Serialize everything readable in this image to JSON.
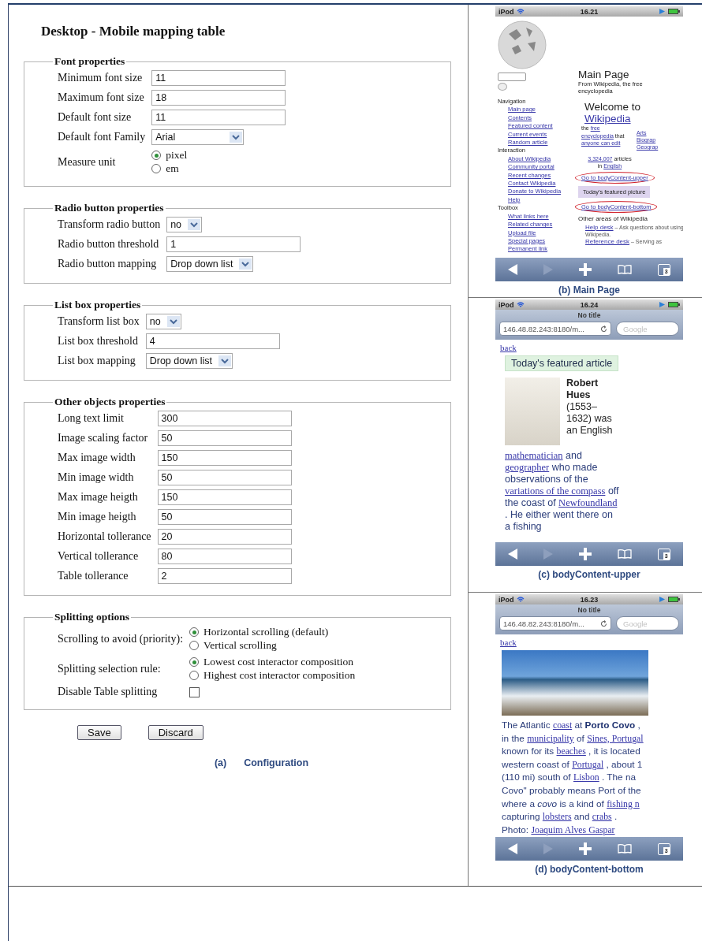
{
  "config": {
    "title": "Desktop - Mobile mapping table",
    "fieldsets": [
      {
        "legend": "Font properties",
        "rows": [
          {
            "kind": "text",
            "label": "Minimum font size",
            "value": "11"
          },
          {
            "kind": "text",
            "label": "Maximum font size",
            "value": "18"
          },
          {
            "kind": "text",
            "label": "Default font size",
            "value": "11"
          },
          {
            "kind": "select",
            "label": "Default font Family",
            "value": "Arial"
          },
          {
            "kind": "radio",
            "label": "Measure unit",
            "options": [
              {
                "label": "pixel",
                "selected": true
              },
              {
                "label": "em",
                "selected": false
              }
            ]
          }
        ]
      },
      {
        "legend": "Radio button properties",
        "rows": [
          {
            "kind": "select",
            "label": "Transform radio button",
            "value": "no"
          },
          {
            "kind": "text",
            "label": "Radio button threshold",
            "value": "1"
          },
          {
            "kind": "select",
            "label": "Radio button mapping",
            "value": "Drop down list"
          }
        ]
      },
      {
        "legend": "List box properties",
        "rows": [
          {
            "kind": "select",
            "label": "Transform list box",
            "value": "no"
          },
          {
            "kind": "text",
            "label": "List box threshold",
            "value": "4"
          },
          {
            "kind": "select",
            "label": "List box mapping",
            "value": "Drop down list"
          }
        ]
      },
      {
        "legend": "Other objects properties",
        "rows": [
          {
            "kind": "text",
            "label": "Long text limit",
            "value": "300"
          },
          {
            "kind": "text",
            "label": "Image scaling factor",
            "value": "50"
          },
          {
            "kind": "text",
            "label": "Max image width",
            "value": "150"
          },
          {
            "kind": "text",
            "label": "Min image width",
            "value": "50"
          },
          {
            "kind": "text",
            "label": "Max image heigth",
            "value": "150"
          },
          {
            "kind": "text",
            "label": "Min image heigth",
            "value": "50"
          },
          {
            "kind": "text",
            "label": "Horizontal tollerance",
            "value": "20"
          },
          {
            "kind": "text",
            "label": "Vertical tollerance",
            "value": "80"
          },
          {
            "kind": "text",
            "label": "Table tollerance",
            "value": "2"
          }
        ]
      },
      {
        "legend": "Splitting options",
        "rows": [
          {
            "kind": "radio",
            "label": "Scrolling to avoid (priority):",
            "options": [
              {
                "label": "Horizontal scrolling (default)",
                "selected": true
              },
              {
                "label": "Vertical scrolling",
                "selected": false
              }
            ]
          },
          {
            "kind": "radio",
            "label": "Splitting selection rule:",
            "options": [
              {
                "label": "Lowest cost interactor composition",
                "selected": true
              },
              {
                "label": "Highest cost interactor composition",
                "selected": false
              }
            ]
          },
          {
            "kind": "checkbox",
            "label": "Disable Table splitting",
            "checked": false
          }
        ]
      }
    ],
    "buttons": [
      "Save",
      "Discard"
    ],
    "caption": {
      "label": "(a)",
      "text": "Configuration"
    }
  },
  "phones": [
    {
      "caption": "(b) Main Page",
      "status": {
        "carrier": "iPod",
        "time": "16.21"
      },
      "toolbar": {
        "forward_enabled": false,
        "tab_count": "3"
      },
      "content": {
        "kind": "wiki-main",
        "sections": [
          {
            "heading": "Navigation",
            "links": [
              "Main page",
              "Contents",
              "Featured content",
              "Current events",
              "Random article"
            ]
          },
          {
            "heading": "Interaction",
            "links": [
              "About Wikipedia",
              "Community portal",
              "Recent changes",
              "Contact Wikipedia",
              "Donate to Wikipedia",
              "Help"
            ]
          },
          {
            "heading": "Toolbox",
            "links": [
              "What links here",
              "Related changes",
              "Upload file",
              "Special pages",
              "Permanent link"
            ]
          }
        ],
        "title": "Main Page",
        "subtitle": "From Wikipedia, the free encyclopedia",
        "welcome": "Welcome to",
        "welcome_link": "Wikipedia",
        "tagline": [
          {
            "text": "the "
          },
          {
            "link": "free"
          },
          {
            "link": "encyclopedia"
          },
          {
            "text": " that "
          },
          {
            "link": "anyone can edit"
          }
        ],
        "portals": [
          "Arts",
          "Biograp",
          "Geograp"
        ],
        "count": [
          {
            "link": "3,324,007"
          },
          {
            "text": " articles in "
          },
          {
            "link": "English"
          }
        ],
        "items": [
          {
            "kind": "jump",
            "text": "Go to bodyContent-upper",
            "circled": true
          },
          {
            "kind": "box",
            "text": "Today's featured picture"
          },
          {
            "kind": "jump",
            "text": "Go to bodyContent-bottom",
            "circled": true
          },
          {
            "kind": "heading",
            "text": "Other areas of Wikipedia"
          },
          {
            "kind": "entry",
            "link": "Help desk",
            "text": " – Ask questions about using Wikipedia."
          },
          {
            "kind": "entry",
            "link": "Reference desk",
            "text": " – Serving as"
          }
        ]
      }
    },
    {
      "caption": "(c) bodyContent-upper",
      "status": {
        "carrier": "iPod",
        "time": "16.24"
      },
      "nav": {
        "title": "No title",
        "url": "146.48.82.243:8180/m...",
        "search_placeholder": "Google"
      },
      "toolbar": {
        "forward_enabled": false,
        "tab_count": "3"
      },
      "content": {
        "kind": "article",
        "blocks": [
          {
            "kind": "link",
            "text": "back"
          },
          {
            "kind": "box",
            "text": "Today's featured article"
          },
          {
            "kind": "figure",
            "segments": [
              {
                "bold": "Robert Hues"
              },
              {
                "text": " (1553–1632) was an English"
              }
            ]
          },
          {
            "kind": "paragraph",
            "segments": [
              {
                "link": "mathematician"
              },
              {
                "text": " and "
              },
              {
                "link": "geographer"
              },
              {
                "text": " who made observations of the "
              },
              {
                "link": "variations of the compass"
              },
              {
                "text": " off the coast of "
              },
              {
                "link": "Newfoundland"
              },
              {
                "text": " . He either went there on a fishing"
              }
            ]
          }
        ]
      }
    },
    {
      "caption": "(d) bodyContent-bottom",
      "status": {
        "carrier": "iPod",
        "time": "16.23"
      },
      "nav": {
        "title": "No title",
        "url": "146.48.82.243:8180/m...",
        "search_placeholder": "Google"
      },
      "toolbar": {
        "forward_enabled": false,
        "tab_count": "3"
      },
      "content": {
        "kind": "article",
        "blocks": [
          {
            "kind": "link",
            "text": "back"
          },
          {
            "kind": "photo"
          },
          {
            "kind": "lines",
            "lines": [
              [
                {
                  "text": "The Atlantic "
                },
                {
                  "link": "coast"
                },
                {
                  "text": " at "
                },
                {
                  "bold": "Porto Covo"
                },
                {
                  "text": " ,"
                }
              ],
              [
                {
                  "text": "in the "
                },
                {
                  "link": "municipality"
                },
                {
                  "text": " of "
                },
                {
                  "link": "Sines, Portugal"
                }
              ],
              [
                {
                  "text": "known for its "
                },
                {
                  "link": "beaches"
                },
                {
                  "text": " , it is located"
                }
              ],
              [
                {
                  "text": "western coast of "
                },
                {
                  "link": "Portugal"
                },
                {
                  "text": " , about 1"
                }
              ],
              [
                {
                  "text": "(110   mi) south of "
                },
                {
                  "link": "Lisbon"
                },
                {
                  "text": " . The na"
                }
              ],
              [
                {
                  "text": "Covo\" probably means Port of the"
                }
              ],
              [
                {
                  "text": "where a "
                },
                {
                  "italic": "covo"
                },
                {
                  "text": " is a kind of "
                },
                {
                  "link": "fishing n"
                }
              ],
              [
                {
                  "text": "capturing "
                },
                {
                  "link": "lobsters"
                },
                {
                  "text": " and "
                },
                {
                  "link": "crabs"
                },
                {
                  "text": " ."
                }
              ],
              [
                {
                  "text": "Photo: "
                },
                {
                  "link": "Joaquim Alves Gaspar"
                }
              ]
            ]
          }
        ]
      }
    }
  ]
}
